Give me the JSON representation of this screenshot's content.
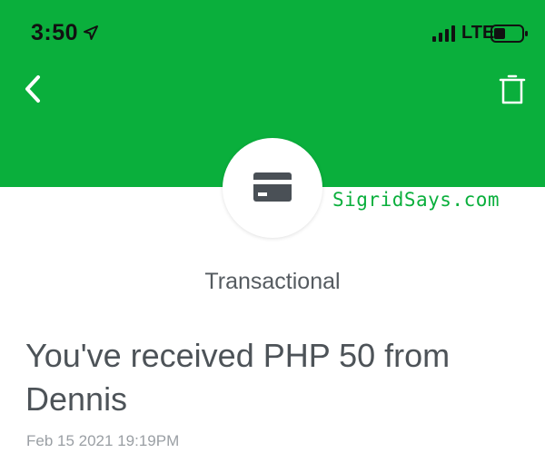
{
  "status_bar": {
    "time": "3:50",
    "network": "LTE",
    "icons": [
      "location-arrow-icon",
      "signal-bars-icon",
      "battery-icon"
    ]
  },
  "header": {
    "back_icon": "chevron-left-icon",
    "action_icon": "trash-icon",
    "color": "#0aaf3c"
  },
  "notification": {
    "icon": "credit-card-icon",
    "category": "Transactional",
    "title": "You've received PHP 50 from Dennis",
    "date": "Feb 15 2021 19:19PM"
  },
  "watermark": "SigridSays.com"
}
